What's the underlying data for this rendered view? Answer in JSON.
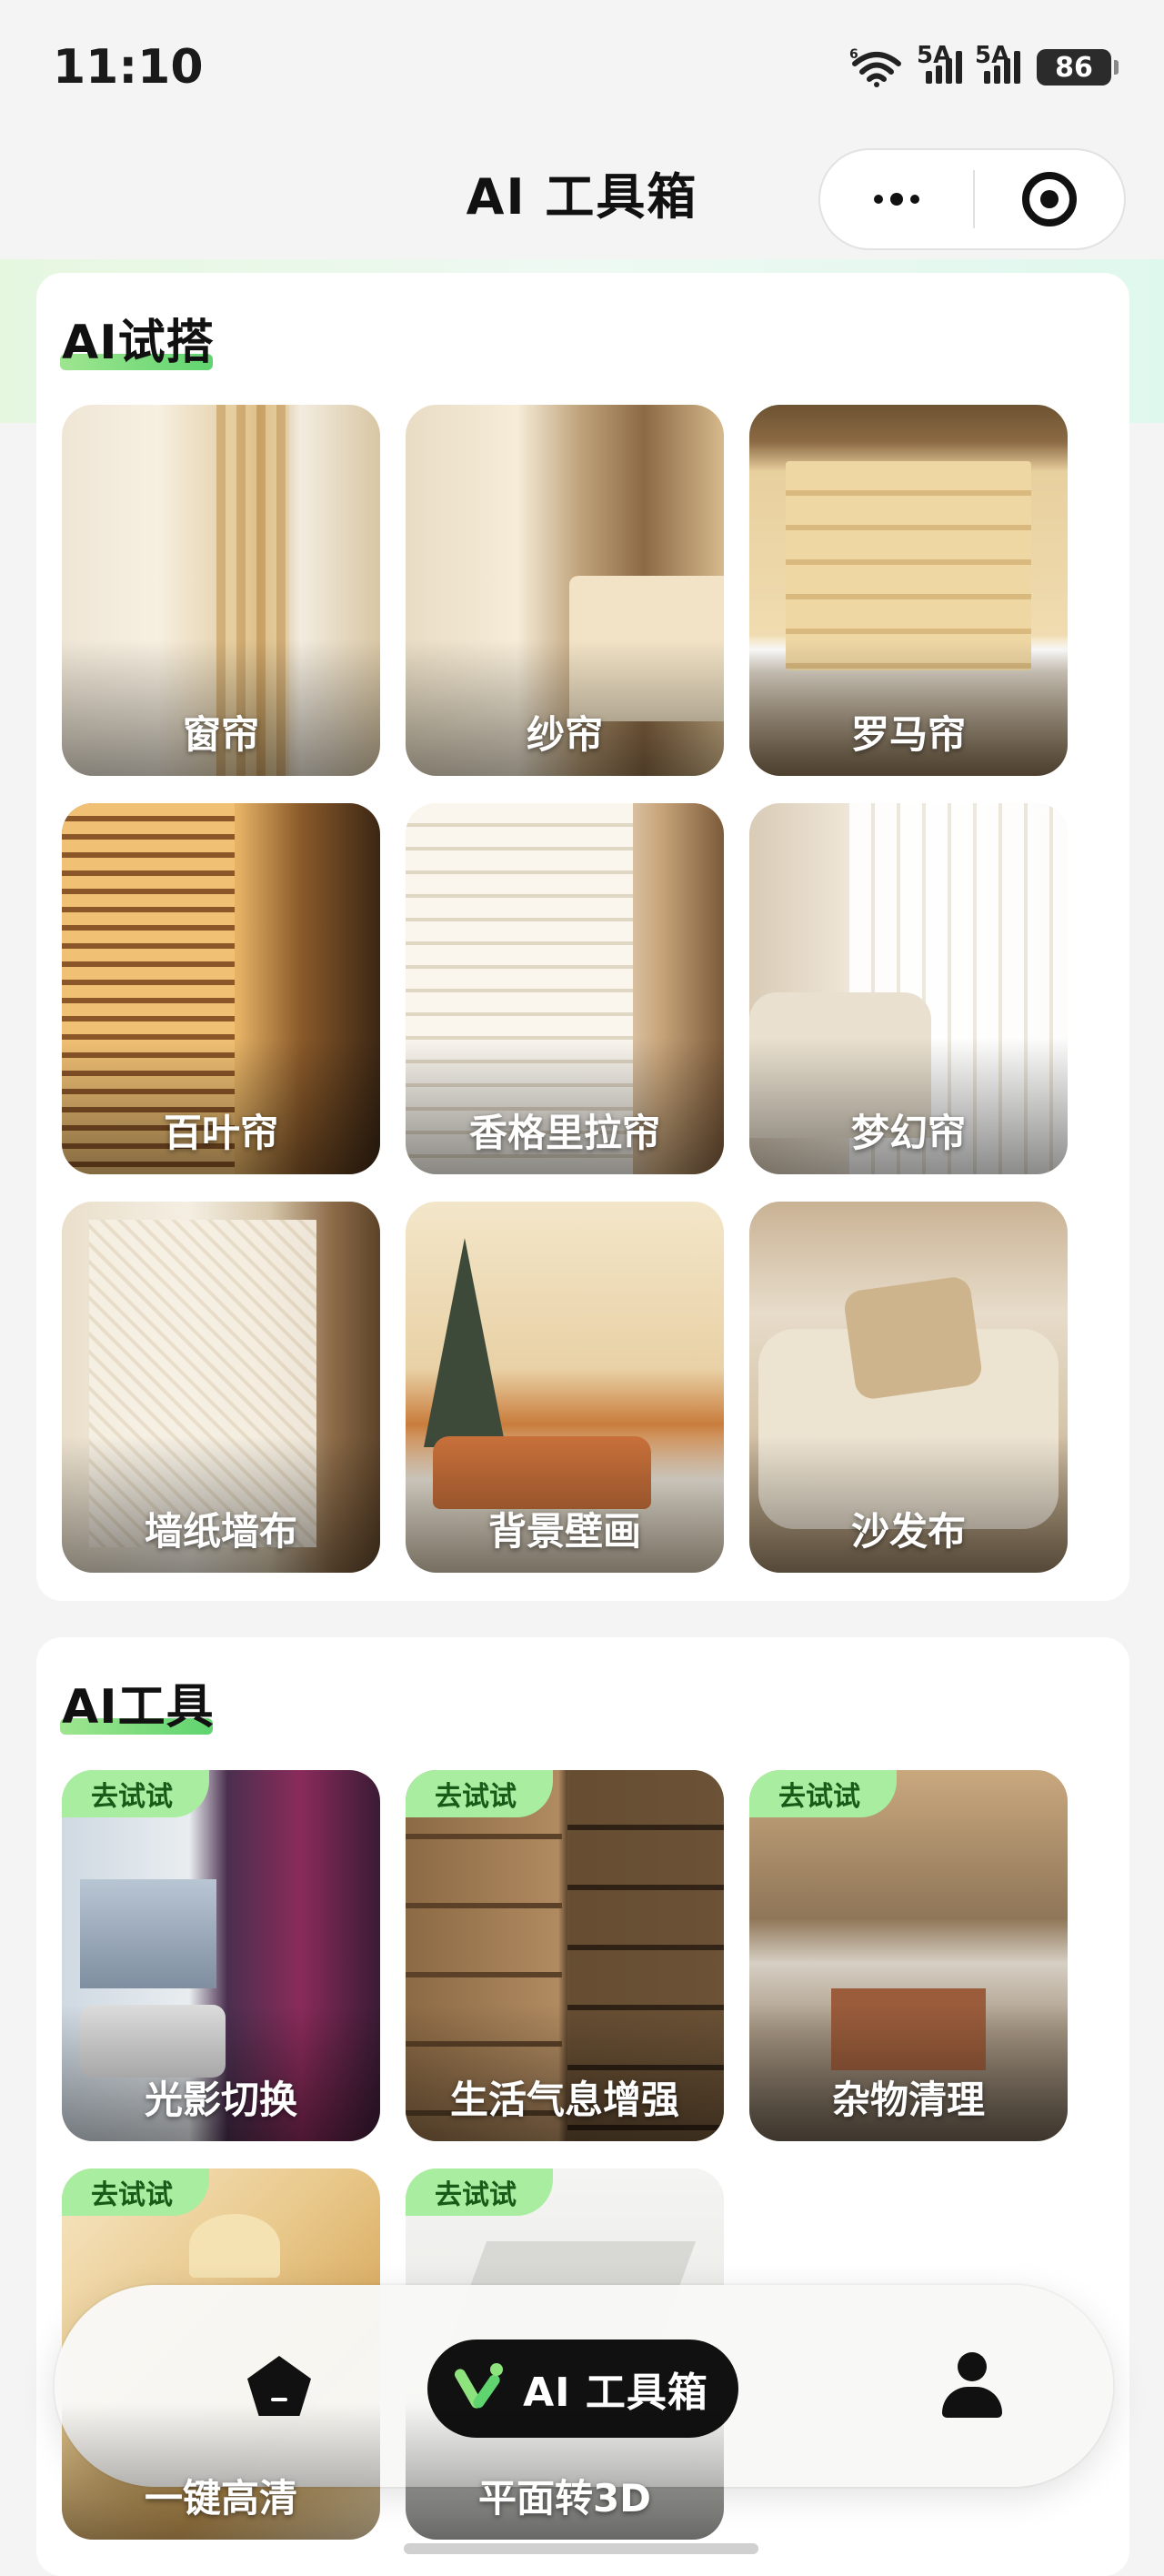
{
  "status_bar": {
    "time": "11:10",
    "wifi_label": "6",
    "signal_1_label": "5A",
    "signal_2_label": "5A",
    "battery": "86"
  },
  "nav": {
    "title": "AI 工具箱",
    "more_icon": "more-dots-icon",
    "close_icon": "target-circle-icon"
  },
  "section_try": {
    "title": "AI试搭",
    "items": [
      {
        "label": "窗帘"
      },
      {
        "label": "纱帘"
      },
      {
        "label": "罗马帘"
      },
      {
        "label": "百叶帘"
      },
      {
        "label": "香格里拉帘"
      },
      {
        "label": "梦幻帘"
      },
      {
        "label": "墙纸墙布"
      },
      {
        "label": "背景壁画"
      },
      {
        "label": "沙发布"
      }
    ]
  },
  "section_tools": {
    "title": "AI工具",
    "items": [
      {
        "label": "光影切换",
        "tag": "去试试"
      },
      {
        "label": "生活气息增强",
        "tag": "去试试"
      },
      {
        "label": "杂物清理",
        "tag": "去试试"
      },
      {
        "label": "一键高清",
        "tag": "去试试"
      },
      {
        "label": "平面转3D",
        "tag": "去试试"
      }
    ]
  },
  "tab_bar": {
    "home_icon": "home-pentagon-icon",
    "ai_label": "AI 工具箱",
    "ai_icon": "ai-toolbox-icon",
    "profile_icon": "user-icon",
    "accent": "#8fe37e"
  }
}
